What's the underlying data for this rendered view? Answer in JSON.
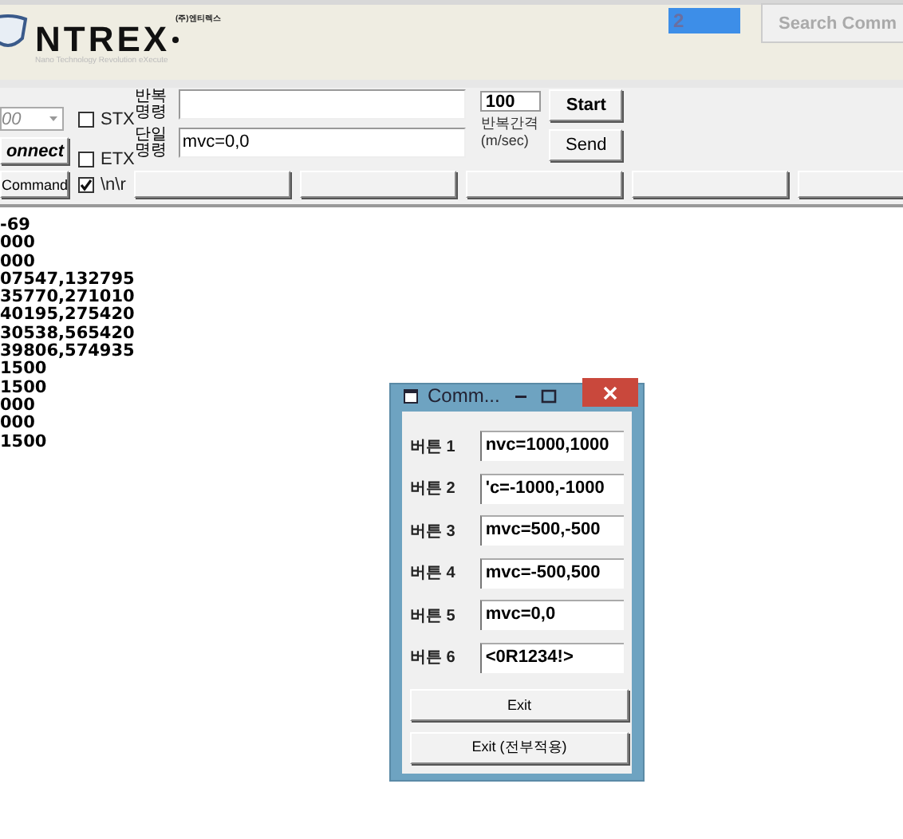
{
  "header": {
    "logo_company": "(주)엔티렉스",
    "logo_name": "NTREX",
    "logo_tagline": "Nano Technology Revolution eXecute",
    "port_field": "2",
    "search_button": "Search Comm"
  },
  "toolbar": {
    "baud_combo": "00",
    "connect_button": "onnect",
    "command_button": "Command",
    "checkboxes": [
      {
        "label": "STX",
        "checked": false
      },
      {
        "label": "ETX",
        "checked": false
      },
      {
        "label": "\\n\\r",
        "checked": true
      }
    ],
    "repeat_label": "반복명령",
    "single_label": "단일명령",
    "single_value": "mvc=0,0",
    "interval_value": "100",
    "interval_label": "반복간격 (m/sec)",
    "start_button": "Start",
    "send_button": "Send"
  },
  "output_lines": [
    "-69",
    "000",
    "000",
    "07547,132795",
    "35770,271010",
    "40195,275420",
    "30538,565420",
    "39806,574935",
    "1500",
    "1500",
    "000",
    "000",
    "1500"
  ],
  "dialog": {
    "title": "Comm...",
    "rows": [
      {
        "label": "버튼 1",
        "value": "nvc=1000,1000"
      },
      {
        "label": "버튼 2",
        "value": "'c=-1000,-1000"
      },
      {
        "label": "버튼 3",
        "value": "mvc=500,-500"
      },
      {
        "label": "버튼 4",
        "value": "mvc=-500,500"
      },
      {
        "label": "버튼 5",
        "value": "mvc=0,0"
      },
      {
        "label": "버튼 6",
        "value": "<0R1234!>"
      }
    ],
    "buttons": [
      "Exit",
      "Exit (전부적용)"
    ]
  }
}
